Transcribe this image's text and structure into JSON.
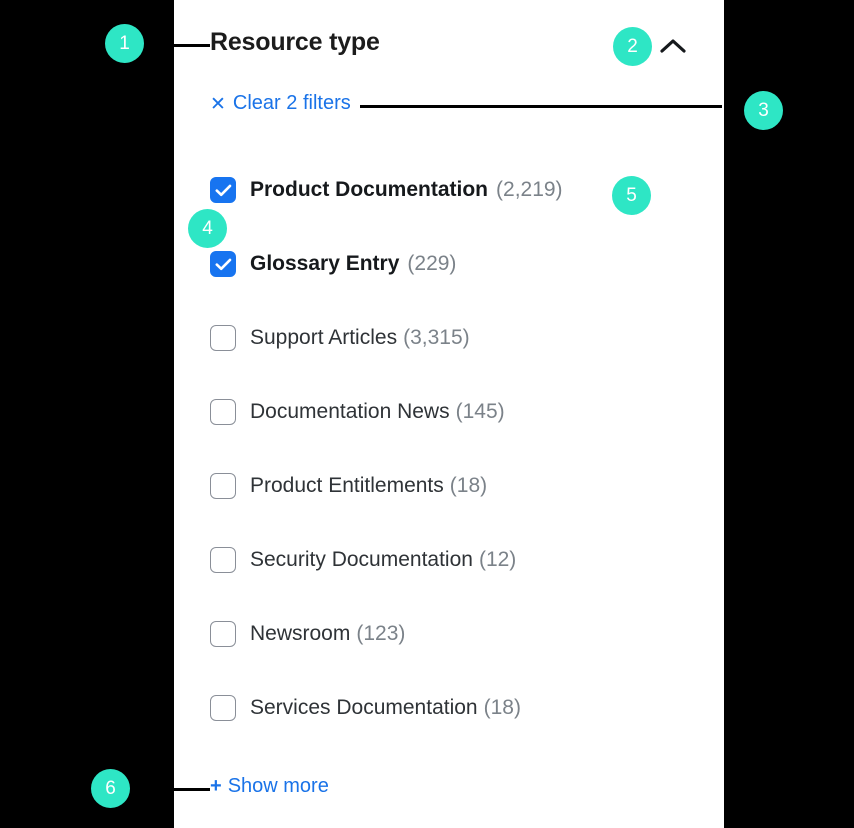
{
  "panel": {
    "title": "Resource type",
    "collapse_icon": "chevron-up-icon",
    "clear_filters": {
      "icon": "close-x-icon",
      "x_glyph": "✕",
      "label": "Clear 2 filters"
    },
    "show_more": {
      "plus_glyph": "+",
      "label": "Show more"
    },
    "options": [
      {
        "label": "Product Documentation",
        "count": "(2,219)",
        "checked": true
      },
      {
        "label": "Glossary Entry",
        "count": "(229)",
        "checked": true
      },
      {
        "label": "Support Articles",
        "count": "(3,315)",
        "checked": false
      },
      {
        "label": "Documentation News",
        "count": "(145)",
        "checked": false
      },
      {
        "label": "Product Entitlements",
        "count": "(18)",
        "checked": false
      },
      {
        "label": "Security Documentation",
        "count": "(12)",
        "checked": false
      },
      {
        "label": "Newsroom",
        "count": "(123)",
        "checked": false
      },
      {
        "label": "Services Documentation",
        "count": "(18)",
        "checked": false
      }
    ]
  },
  "annotations": {
    "accent_color": "#2ee6c5",
    "badges": [
      {
        "number": "1"
      },
      {
        "number": "2"
      },
      {
        "number": "3"
      },
      {
        "number": "4"
      },
      {
        "number": "5"
      },
      {
        "number": "6"
      }
    ]
  },
  "colors": {
    "checkbox_checked": "#1774f0",
    "link": "#1a73e8",
    "badge": "#2ee6c5",
    "panel_background": "#ffffff",
    "page_background": "#000000"
  }
}
